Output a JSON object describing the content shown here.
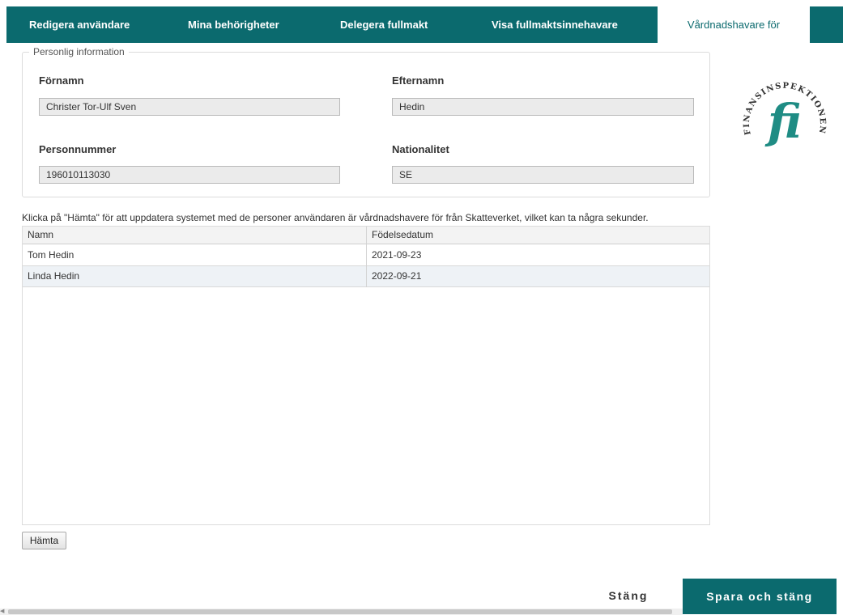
{
  "tabs": [
    {
      "label": "Redigera användare"
    },
    {
      "label": "Mina behörigheter"
    },
    {
      "label": "Delegera fullmakt"
    },
    {
      "label": "Visa fullmaktsinnehavare"
    },
    {
      "label": "Vårdnadshavare för"
    }
  ],
  "personal_info": {
    "legend": "Personlig information",
    "first_name": {
      "label": "Förnamn",
      "value": "Christer Tor-Ulf Sven"
    },
    "last_name": {
      "label": "Efternamn",
      "value": "Hedin"
    },
    "personal_number": {
      "label": "Personnummer",
      "value": "196010113030"
    },
    "nationality": {
      "label": "Nationalitet",
      "value": "SE"
    }
  },
  "logo": {
    "text": "FINANSINSPEKTIONEN",
    "glyph": "fi",
    "color": "#1f8c84"
  },
  "hint": "Klicka på \"Hämta\" för att uppdatera systemet med de personer användaren är vårdnadshavere för från Skatteverket, vilket kan ta några sekunder.",
  "grid": {
    "columns": [
      "Namn",
      "Födelsedatum"
    ],
    "rows": [
      [
        "Tom Hedin",
        "2021-09-23"
      ],
      [
        "Linda Hedin",
        "2022-09-21"
      ]
    ]
  },
  "buttons": {
    "fetch": "Hämta",
    "close": "Stäng",
    "save_close": "Spara och stäng"
  },
  "colors": {
    "accent": "#0b6a6e",
    "selected_row": "#eef2f6"
  }
}
